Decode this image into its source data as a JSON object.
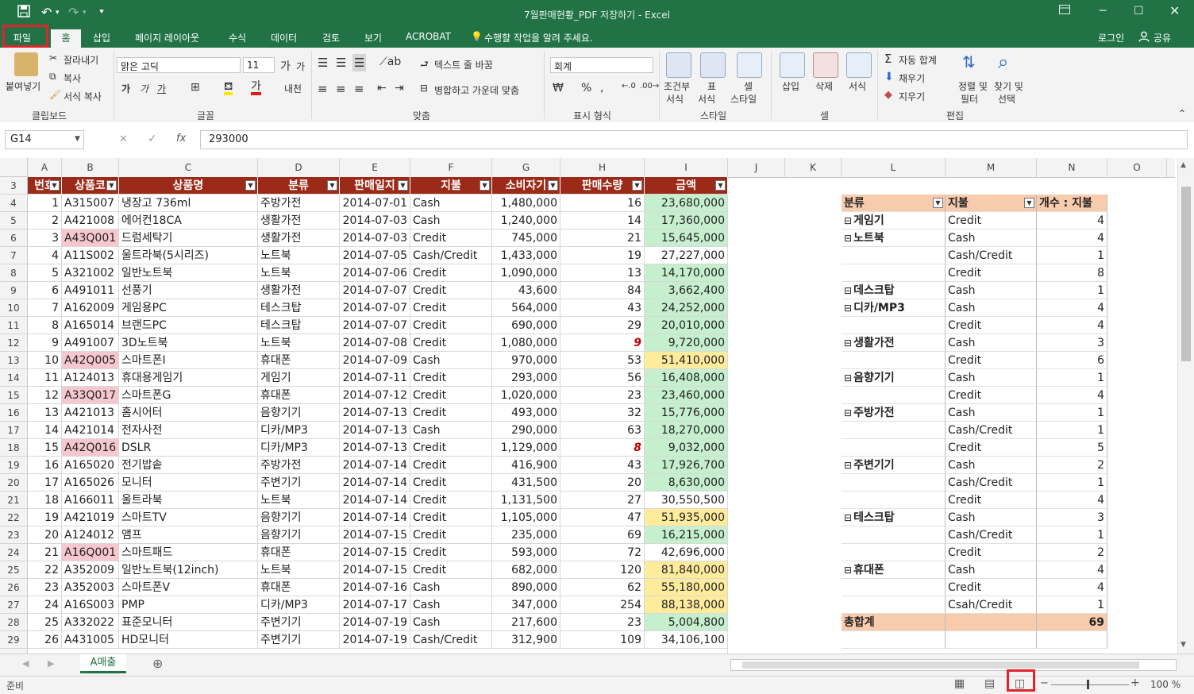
{
  "window": {
    "title": "7월판매현황_PDF 저장하기 - Excel",
    "signin": "로그인",
    "share": "공유"
  },
  "tabs": [
    "파일",
    "홈",
    "삽입",
    "페이지 레이아웃",
    "수식",
    "데이터",
    "검토",
    "보기",
    "ACROBAT"
  ],
  "tell_me": "수행할 작업을 알려 주세요.",
  "ribbon": {
    "clipboard": {
      "paste": "붙여넣기",
      "cut": "잘라내기",
      "copy": "복사",
      "format_painter": "서식 복사",
      "label": "클립보드"
    },
    "font": {
      "name": "맑은 고딕",
      "size": "11",
      "label": "글꼴"
    },
    "align": {
      "wrap": "텍스트 줄 바꿈",
      "merge": "병합하고 가운데 맞춤",
      "label": "맞춤"
    },
    "number": {
      "format": "회계",
      "label": "표시 형식"
    },
    "styles": {
      "cond_line1": "조건부",
      "cond_line2": "서식",
      "table_line1": "표",
      "table_line2": "서식",
      "cell_line1": "셀",
      "cell_line2": "스타일",
      "label": "스타일"
    },
    "cells": {
      "insert": "삽입",
      "delete": "삭제",
      "format": "서식",
      "label": "셀"
    },
    "editing": {
      "autosum": "자동 합계",
      "fill": "채우기",
      "clear": "지우기",
      "sort_line1": "정렬 및",
      "sort_line2": "필터",
      "find_line1": "찾기 및",
      "find_line2": "선택",
      "label": "편집"
    }
  },
  "formula_bar": {
    "name_box": "G14",
    "formula": "293000"
  },
  "columns": [
    "A",
    "B",
    "C",
    "D",
    "E",
    "F",
    "G",
    "H",
    "I",
    "J",
    "K",
    "L",
    "M",
    "N",
    "O"
  ],
  "table_headers": [
    "번호",
    "상품코",
    "상품명",
    "분류",
    "판매일지",
    "지불",
    "소비자기",
    "판매수량",
    "금액"
  ],
  "rows": [
    {
      "r": "4",
      "no": "1",
      "code": "A315007",
      "name": "냉장고 736ml",
      "cat": "주방가전",
      "date": "2014-07-01",
      "pay": "Cash",
      "price": "1,480,000",
      "qty": "16",
      "amt": "23,680,000"
    },
    {
      "r": "5",
      "no": "2",
      "code": "A421008",
      "name": "에어컨18CA",
      "cat": "생활가전",
      "date": "2014-07-03",
      "pay": "Cash",
      "price": "1,240,000",
      "qty": "14",
      "amt": "17,360,000"
    },
    {
      "r": "6",
      "no": "3",
      "code": "A43Q001",
      "name": "드럼세탁기",
      "cat": "생활가전",
      "date": "2014-07-03",
      "pay": "Credit",
      "price": "745,000",
      "qty": "21",
      "amt": "15,645,000"
    },
    {
      "r": "7",
      "no": "4",
      "code": "A11S002",
      "name": "울트라북(5시리즈)",
      "cat": "노트북",
      "date": "2014-07-05",
      "pay": "Cash/Credit",
      "price": "1,433,000",
      "qty": "19",
      "amt": "27,227,000"
    },
    {
      "r": "8",
      "no": "5",
      "code": "A321002",
      "name": "일반노트북",
      "cat": "노트북",
      "date": "2014-07-06",
      "pay": "Credit",
      "price": "1,090,000",
      "qty": "13",
      "amt": "14,170,000"
    },
    {
      "r": "9",
      "no": "6",
      "code": "A491011",
      "name": "선풍기",
      "cat": "생활가전",
      "date": "2014-07-07",
      "pay": "Credit",
      "price": "43,600",
      "qty": "84",
      "amt": "3,662,400"
    },
    {
      "r": "10",
      "no": "7",
      "code": "A162009",
      "name": "게임용PC",
      "cat": "테스크탑",
      "date": "2014-07-07",
      "pay": "Credit",
      "price": "564,000",
      "qty": "43",
      "amt": "24,252,000"
    },
    {
      "r": "11",
      "no": "8",
      "code": "A165014",
      "name": "브랜드PC",
      "cat": "테스크탑",
      "date": "2014-07-07",
      "pay": "Credit",
      "price": "690,000",
      "qty": "29",
      "amt": "20,010,000"
    },
    {
      "r": "12",
      "no": "9",
      "code": "A491007",
      "name": "3D노트북",
      "cat": "노트북",
      "date": "2014-07-08",
      "pay": "Credit",
      "price": "1,080,000",
      "qty": "9",
      "amt": "9,720,000"
    },
    {
      "r": "13",
      "no": "10",
      "code": "A42Q005",
      "name": "스마트폰I",
      "cat": "휴대폰",
      "date": "2014-07-09",
      "pay": "Cash",
      "price": "970,000",
      "qty": "53",
      "amt": "51,410,000"
    },
    {
      "r": "14",
      "no": "11",
      "code": "A124013",
      "name": "휴대용게임기",
      "cat": "게임기",
      "date": "2014-07-11",
      "pay": "Credit",
      "price": "293,000",
      "qty": "56",
      "amt": "16,408,000"
    },
    {
      "r": "15",
      "no": "12",
      "code": "A33Q017",
      "name": "스마트폰G",
      "cat": "휴대폰",
      "date": "2014-07-12",
      "pay": "Credit",
      "price": "1,020,000",
      "qty": "23",
      "amt": "23,460,000"
    },
    {
      "r": "16",
      "no": "13",
      "code": "A421013",
      "name": "홈시어터",
      "cat": "음향기기",
      "date": "2014-07-13",
      "pay": "Credit",
      "price": "493,000",
      "qty": "32",
      "amt": "15,776,000"
    },
    {
      "r": "17",
      "no": "14",
      "code": "A421014",
      "name": "전자사전",
      "cat": "디카/MP3",
      "date": "2014-07-13",
      "pay": "Cash",
      "price": "290,000",
      "qty": "63",
      "amt": "18,270,000"
    },
    {
      "r": "18",
      "no": "15",
      "code": "A42Q016",
      "name": "DSLR",
      "cat": "디카/MP3",
      "date": "2014-07-13",
      "pay": "Credit",
      "price": "1,129,000",
      "qty": "8",
      "amt": "9,032,000"
    },
    {
      "r": "19",
      "no": "16",
      "code": "A165020",
      "name": "전기밥솥",
      "cat": "주방가전",
      "date": "2014-07-14",
      "pay": "Credit",
      "price": "416,900",
      "qty": "43",
      "amt": "17,926,700"
    },
    {
      "r": "20",
      "no": "17",
      "code": "A165026",
      "name": "모니터",
      "cat": "주변기기",
      "date": "2014-07-14",
      "pay": "Credit",
      "price": "431,500",
      "qty": "20",
      "amt": "8,630,000"
    },
    {
      "r": "21",
      "no": "18",
      "code": "A166011",
      "name": "울트라북",
      "cat": "노트북",
      "date": "2014-07-14",
      "pay": "Credit",
      "price": "1,131,500",
      "qty": "27",
      "amt": "30,550,500"
    },
    {
      "r": "22",
      "no": "19",
      "code": "A421019",
      "name": "스마트TV",
      "cat": "음향기기",
      "date": "2014-07-14",
      "pay": "Credit",
      "price": "1,105,000",
      "qty": "47",
      "amt": "51,935,000"
    },
    {
      "r": "23",
      "no": "20",
      "code": "A124012",
      "name": "앰프",
      "cat": "음향기기",
      "date": "2014-07-15",
      "pay": "Credit",
      "price": "235,000",
      "qty": "69",
      "amt": "16,215,000"
    },
    {
      "r": "24",
      "no": "21",
      "code": "A16Q001",
      "name": "스마트패드",
      "cat": "휴대폰",
      "date": "2014-07-15",
      "pay": "Credit",
      "price": "593,000",
      "qty": "72",
      "amt": "42,696,000"
    },
    {
      "r": "25",
      "no": "22",
      "code": "A352009",
      "name": "일반노트북(12inch)",
      "cat": "노트북",
      "date": "2014-07-15",
      "pay": "Credit",
      "price": "682,000",
      "qty": "120",
      "amt": "81,840,000"
    },
    {
      "r": "26",
      "no": "23",
      "code": "A352003",
      "name": "스마트폰V",
      "cat": "휴대폰",
      "date": "2014-07-16",
      "pay": "Cash",
      "price": "890,000",
      "qty": "62",
      "amt": "55,180,000"
    },
    {
      "r": "27",
      "no": "24",
      "code": "A16S003",
      "name": "PMP",
      "cat": "디카/MP3",
      "date": "2014-07-17",
      "pay": "Cash",
      "price": "347,000",
      "qty": "254",
      "amt": "88,138,000"
    },
    {
      "r": "28",
      "no": "25",
      "code": "A332022",
      "name": "표준모니터",
      "cat": "주변기기",
      "date": "2014-07-19",
      "pay": "Cash",
      "price": "217,600",
      "qty": "23",
      "amt": "5,004,800"
    },
    {
      "r": "29",
      "no": "26",
      "code": "A431005",
      "name": "HD모니터",
      "cat": "주변기기",
      "date": "2014-07-19",
      "pay": "Cash/Credit",
      "price": "312,900",
      "qty": "109",
      "amt": "34,106,100"
    }
  ],
  "pivot": {
    "headers": [
      "분류",
      "지불",
      "개수 : 지불"
    ],
    "rows": [
      {
        "cat": "게임기",
        "pay": "Credit",
        "count": "4"
      },
      {
        "cat": "노트북",
        "pay": "Cash",
        "count": "4"
      },
      {
        "cat": "",
        "pay": "Cash/Credit",
        "count": "1"
      },
      {
        "cat": "",
        "pay": "Credit",
        "count": "8"
      },
      {
        "cat": "데스크탑",
        "pay": "Cash",
        "count": "1"
      },
      {
        "cat": "디카/MP3",
        "pay": "Cash",
        "count": "4"
      },
      {
        "cat": "",
        "pay": "Credit",
        "count": "4"
      },
      {
        "cat": "생활가전",
        "pay": "Cash",
        "count": "3"
      },
      {
        "cat": "",
        "pay": "Credit",
        "count": "6"
      },
      {
        "cat": "음향기기",
        "pay": "Cash",
        "count": "1"
      },
      {
        "cat": "",
        "pay": "Credit",
        "count": "4"
      },
      {
        "cat": "주방가전",
        "pay": "Cash",
        "count": "1"
      },
      {
        "cat": "",
        "pay": "Cash/Credit",
        "count": "1"
      },
      {
        "cat": "",
        "pay": "Credit",
        "count": "5"
      },
      {
        "cat": "주변기기",
        "pay": "Cash",
        "count": "2"
      },
      {
        "cat": "",
        "pay": "Cash/Credit",
        "count": "1"
      },
      {
        "cat": "",
        "pay": "Credit",
        "count": "4"
      },
      {
        "cat": "테스크탑",
        "pay": "Cash",
        "count": "3"
      },
      {
        "cat": "",
        "pay": "Cash/Credit",
        "count": "1"
      },
      {
        "cat": "",
        "pay": "Credit",
        "count": "2"
      },
      {
        "cat": "휴대폰",
        "pay": "Cash",
        "count": "4"
      },
      {
        "cat": "",
        "pay": "Credit",
        "count": "4"
      },
      {
        "cat": "",
        "pay": "Csah/Credit",
        "count": "1"
      }
    ],
    "total_label": "총합계",
    "total_value": "69"
  },
  "sheet_tab": "A매출",
  "status": {
    "ready": "준비",
    "zoom": "100 %"
  },
  "colors": {
    "excel_green": "#217346",
    "header_red": "#9c2a18",
    "highlight_red": "#e0232d"
  }
}
